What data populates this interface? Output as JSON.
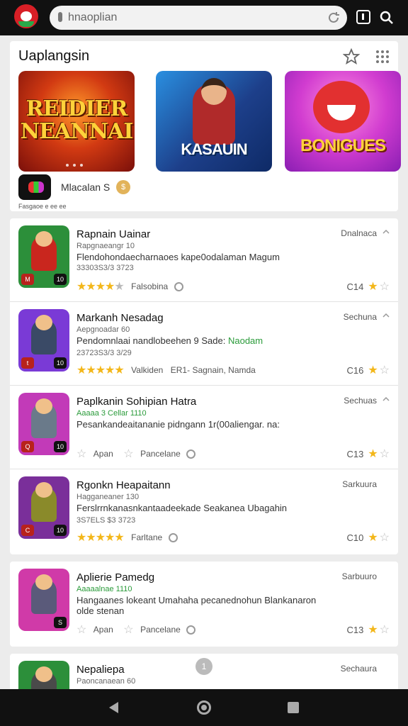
{
  "browser": {
    "url": "hnaoplian"
  },
  "featured": {
    "title": "Uaplangsin",
    "tiles": [
      {
        "caption": "REIDIER NEANNAI"
      },
      {
        "caption": "KASAUIN"
      },
      {
        "caption": "BONIGUES"
      }
    ],
    "developer_label": "Fasgaoe e ee ee",
    "name": "Mlacalan S",
    "coin_label": "$"
  },
  "apps": [
    {
      "name": "Rapnain Uainar",
      "subtitle": "Rapgnaeangr 10",
      "description": "Flendohondaecharnaoes kape0odalaman Magum",
      "meta": "33303S3/3 3723",
      "rating": 4,
      "rating_label": "Falsobina",
      "status": "Dnalnaca",
      "size": "C14",
      "badges": [
        "M",
        "10"
      ],
      "icon_bg": "#2c8f3a",
      "figure": "#c9261e"
    },
    {
      "name": "Markanh Nesadag",
      "subtitle": "Aepgnoadar 60",
      "description": "Pendomnlaai nandlobeehen 9 Sade:",
      "description_highlight": "Naodam",
      "meta": "23723S3/3 3/29",
      "rating": 5,
      "rating_label": "Valkiden",
      "rating_extra": "ER1- Sagnain, Namda",
      "status": "Sechuna",
      "size": "C16",
      "badges": [
        "t",
        "10"
      ],
      "icon_bg": "#7a3ad6",
      "figure": "#3a4a66"
    },
    {
      "name": "Paplkanin Sohipian Hatra",
      "subtitle": "Aaaaa 3 Cellar 1110",
      "description": "Pesankandeaitananie pidngann 1r(00aliengar. na:",
      "meta": "",
      "rating": 1,
      "rating_label": "Apan",
      "rating_extra": "Pancelane",
      "status": "Sechuas",
      "size": "C13",
      "badges": [
        "Q",
        "10"
      ],
      "icon_bg": "#c23ab8",
      "figure": "#6a7a8a"
    },
    {
      "name": "Rgonkn Heapaitann",
      "subtitle": "Hagganeaner 130",
      "description": "Ferslrrnkanasnkantaadeekade Seakanea Ubagahin",
      "meta": "3S7ELS $3 3723",
      "rating": 5,
      "rating_label": "Farltane",
      "status": "Sarkuura",
      "size": "C10",
      "badges": [
        "C",
        "10"
      ],
      "icon_bg": "#7a2f9a",
      "figure": "#8a8a2a"
    },
    {
      "name": "Aplierie Pamedg",
      "subtitle": "Aaaaalnae 1110",
      "description": "Hangaanes lokeant Umahaha pecanednohun Blankanaron olde stenan",
      "meta": "",
      "rating": 1,
      "rating_label": "Apan",
      "rating_extra": "Pancelane",
      "status": "Sarbuuro",
      "size": "C13",
      "badges": [
        "",
        "S"
      ],
      "icon_bg": "#d03aa8",
      "figure": "#5a5a7a"
    },
    {
      "name": "Nepaliepa",
      "subtitle": "Paoncanaean 60",
      "status": "Sechaura",
      "icon_bg": "#2c8f3a",
      "figure": "#4a4a4a"
    }
  ],
  "page_badge": "1"
}
